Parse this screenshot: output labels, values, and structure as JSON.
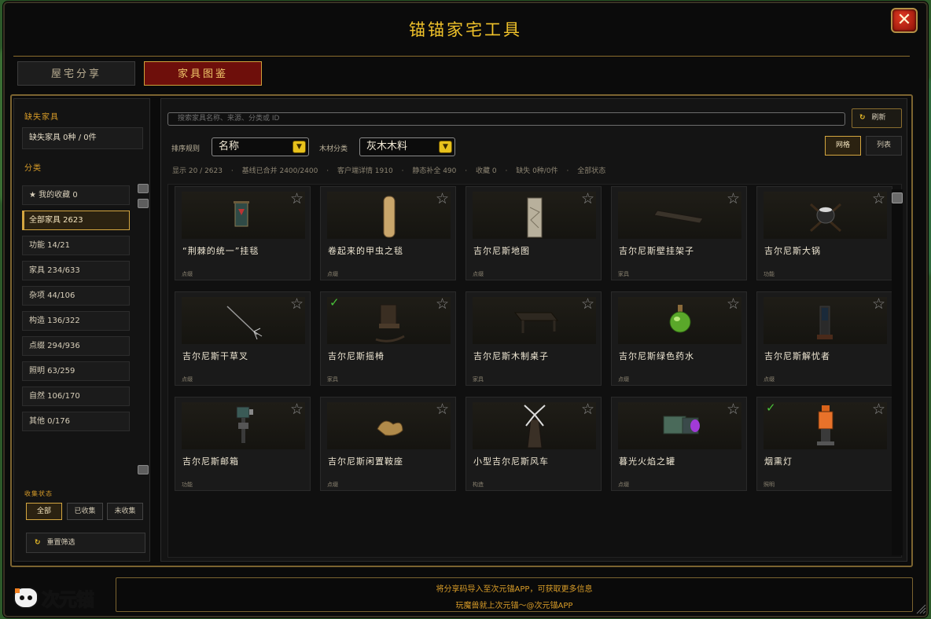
{
  "window": {
    "title": "锚锚家宅工具",
    "close_label": "✕"
  },
  "tabs": [
    {
      "label": "屋宅分享",
      "active": false
    },
    {
      "label": "家具图鉴",
      "active": true
    }
  ],
  "sidebar": {
    "missing_title": "缺失家具",
    "missing_value": "缺失家具  0种 / 0件",
    "category_title": "分类",
    "categories": [
      {
        "label": "★  我的收藏  0",
        "active": false
      },
      {
        "label": "全部家具  2623",
        "active": true
      },
      {
        "label": "功能  14/21",
        "active": false
      },
      {
        "label": "家具  234/633",
        "active": false
      },
      {
        "label": "杂项  44/106",
        "active": false
      },
      {
        "label": "构造  136/322",
        "active": false
      },
      {
        "label": "点缀  294/936",
        "active": false
      },
      {
        "label": "照明  63/259",
        "active": false
      },
      {
        "label": "自然  106/170",
        "active": false
      },
      {
        "label": "其他  0/176",
        "active": false
      }
    ],
    "collect_title": "收集状态",
    "collect_filters": [
      {
        "label": "全部",
        "active": true
      },
      {
        "label": "已收集",
        "active": false
      },
      {
        "label": "未收集",
        "active": false
      }
    ],
    "reset_label": "重置筛选"
  },
  "toolbar": {
    "search_placeholder": "搜索家具名称、来源、分类或 ID",
    "refresh_label": "刷新",
    "sort_label": "排序规则",
    "sort_value": "名称",
    "wood_label": "木材分类",
    "wood_value": "灰木木料",
    "view_grid": "网格",
    "view_list": "列表"
  },
  "stats": [
    "显示 20 / 2623",
    "·",
    "基线已合并 2400/2400",
    "·",
    "客户端详情 1910",
    "·",
    "静态补全 490",
    "·",
    "收藏 0",
    "·",
    "缺失 0种/0件",
    "·",
    "全部状态"
  ],
  "items": [
    {
      "name": "“荆棘的统一”挂毯",
      "category": "点缀",
      "collected": false,
      "icon": "tapestry-icon"
    },
    {
      "name": "卷起来的甲虫之毯",
      "category": "点缀",
      "collected": false,
      "icon": "rolled-rug-icon"
    },
    {
      "name": "吉尔尼斯地图",
      "category": "点缀",
      "collected": false,
      "icon": "map-icon"
    },
    {
      "name": "吉尔尼斯壁挂架子",
      "category": "家具",
      "collected": false,
      "icon": "wall-shelf-icon"
    },
    {
      "name": "吉尔尼斯大锅",
      "category": "功能",
      "collected": false,
      "icon": "cauldron-icon"
    },
    {
      "name": "吉尔尼斯干草叉",
      "category": "点缀",
      "collected": false,
      "icon": "pitchfork-icon"
    },
    {
      "name": "吉尔尼斯摇椅",
      "category": "家具",
      "collected": true,
      "icon": "rocking-chair-icon"
    },
    {
      "name": "吉尔尼斯木制桌子",
      "category": "家具",
      "collected": false,
      "icon": "table-icon"
    },
    {
      "name": "吉尔尼斯绿色药水",
      "category": "点缀",
      "collected": false,
      "icon": "potion-icon"
    },
    {
      "name": "吉尔尼斯解忧者",
      "category": "点缀",
      "collected": false,
      "icon": "cage-icon"
    },
    {
      "name": "吉尔尼斯邮箱",
      "category": "功能",
      "collected": false,
      "icon": "mailbox-icon"
    },
    {
      "name": "吉尔尼斯闲置鞍座",
      "category": "点缀",
      "collected": false,
      "icon": "saddle-icon"
    },
    {
      "name": "小型吉尔尼斯风车",
      "category": "构造",
      "collected": false,
      "icon": "windmill-icon"
    },
    {
      "name": "暮光火焰之罐",
      "category": "点缀",
      "collected": false,
      "icon": "flame-jar-icon"
    },
    {
      "name": "烟熏灯",
      "category": "照明",
      "collected": true,
      "icon": "lantern-icon"
    }
  ],
  "footer": {
    "line1": "将分享码导入至次元锚APP，可获取更多信息",
    "line2": "玩魔兽就上次元锚～@次元锚APP"
  },
  "brand": {
    "text": "次元锚"
  }
}
